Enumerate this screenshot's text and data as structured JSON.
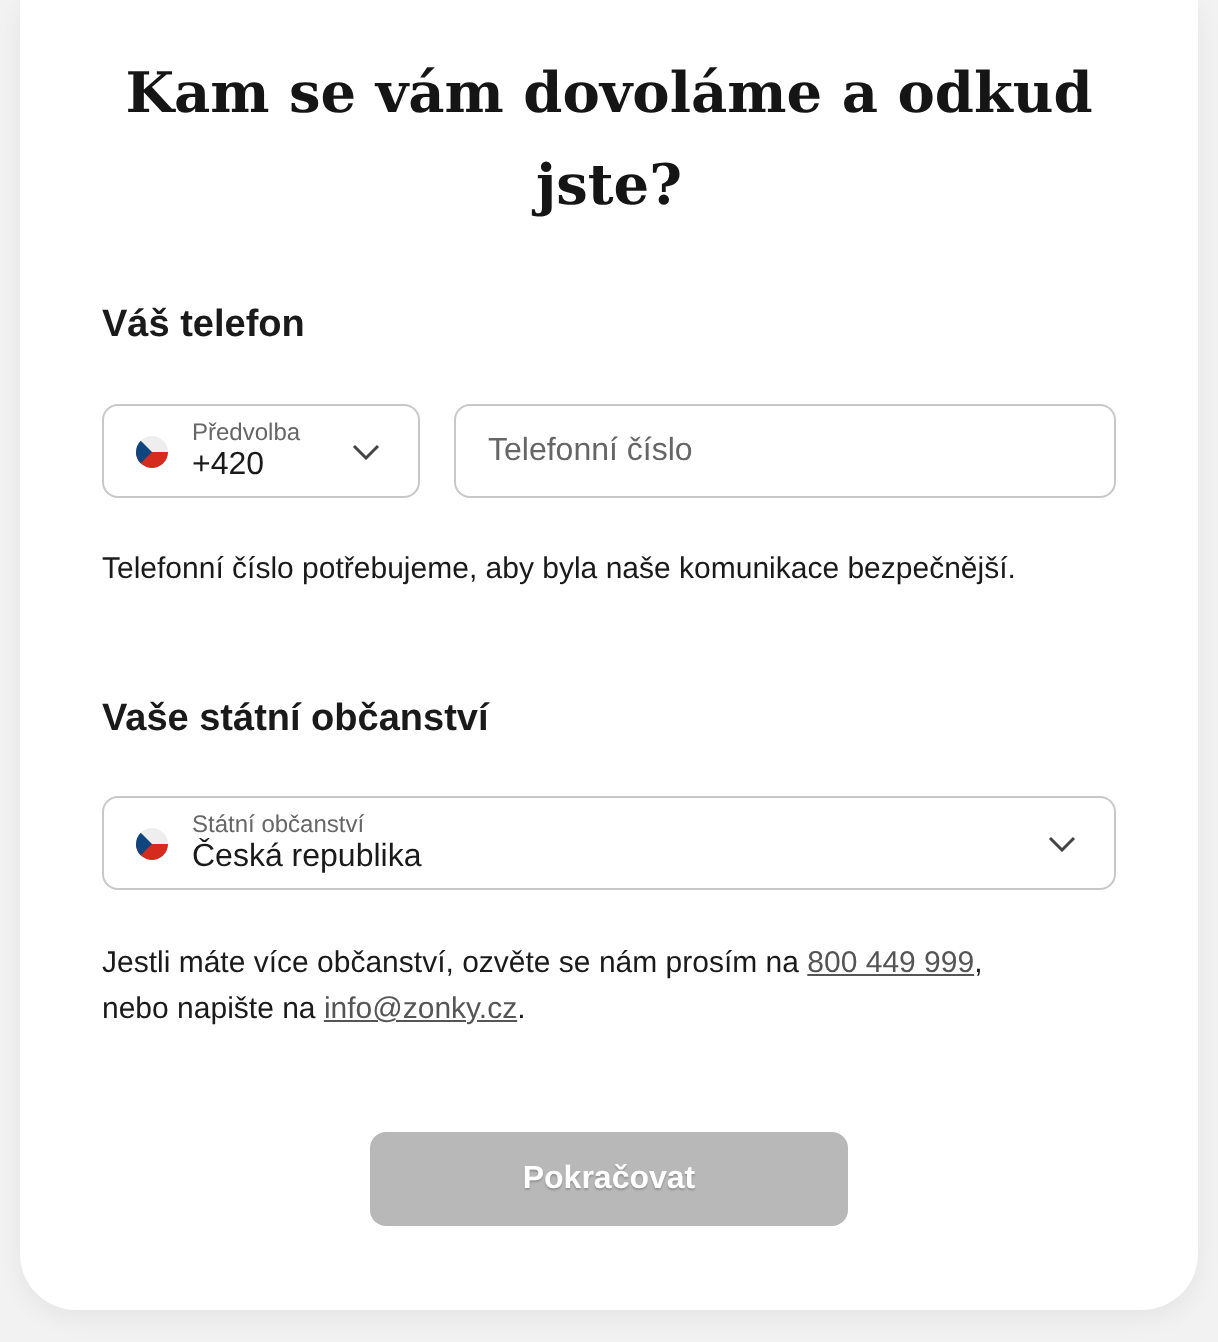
{
  "title": "Kam se vám dovoláme a odkud jste?",
  "phone_section": {
    "heading": "Váš telefon",
    "prefix_select": {
      "label": "Předvolba",
      "value": "+420"
    },
    "phone_field": {
      "placeholder": "Telefonní číslo"
    },
    "help_text": "Telefonní číslo potřebujeme, aby byla naše komunikace bezpečnější."
  },
  "citizenship_section": {
    "heading": "Vaše státní občanství",
    "country_select": {
      "label": "Státní občanství",
      "value": "Česká republika"
    },
    "note": {
      "text_before": "Jestli máte více občanství, ozvěte se nám prosím na ",
      "phone_link": "800 449 999",
      "text_middle": ", nebo napište na ",
      "email_link": "info@zonky.cz",
      "text_after": "."
    }
  },
  "continue_button": {
    "label": "Pokračovat",
    "disabled": true
  }
}
